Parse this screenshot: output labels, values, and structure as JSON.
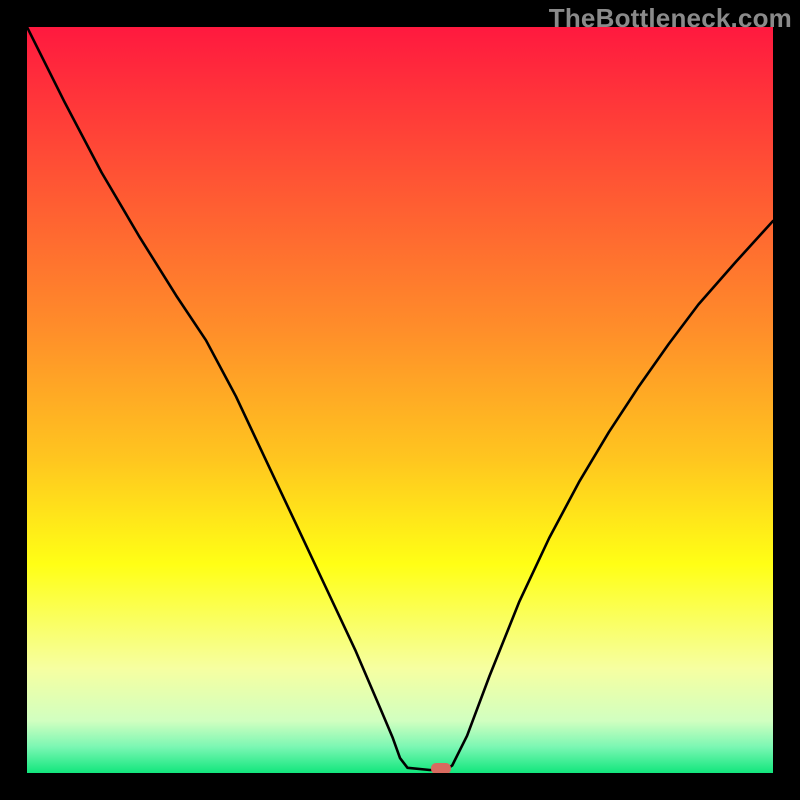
{
  "watermark": "TheBottleneck.com",
  "chart_data": {
    "type": "line",
    "title": "",
    "xlabel": "",
    "ylabel": "",
    "xlim": [
      0,
      1
    ],
    "ylim": [
      0,
      1
    ],
    "gradient_stops": [
      {
        "offset": 0.0,
        "color": "#ff193f"
      },
      {
        "offset": 0.2,
        "color": "#ff5334"
      },
      {
        "offset": 0.4,
        "color": "#ff8c2a"
      },
      {
        "offset": 0.58,
        "color": "#ffc61f"
      },
      {
        "offset": 0.72,
        "color": "#ffff15"
      },
      {
        "offset": 0.86,
        "color": "#f6ffa1"
      },
      {
        "offset": 0.93,
        "color": "#d1ffc0"
      },
      {
        "offset": 0.965,
        "color": "#7bf7b3"
      },
      {
        "offset": 1.0,
        "color": "#12e67d"
      }
    ],
    "x": [
      0.0,
      0.05,
      0.1,
      0.15,
      0.2,
      0.24,
      0.28,
      0.32,
      0.36,
      0.4,
      0.44,
      0.47,
      0.49,
      0.5,
      0.51,
      0.54,
      0.56,
      0.57,
      0.59,
      0.62,
      0.66,
      0.7,
      0.74,
      0.78,
      0.82,
      0.86,
      0.9,
      0.95,
      1.0
    ],
    "y": [
      1.0,
      0.9,
      0.805,
      0.72,
      0.64,
      0.58,
      0.505,
      0.42,
      0.335,
      0.25,
      0.165,
      0.095,
      0.048,
      0.02,
      0.007,
      0.004,
      0.004,
      0.01,
      0.05,
      0.13,
      0.23,
      0.315,
      0.39,
      0.457,
      0.518,
      0.575,
      0.628,
      0.685,
      0.74
    ],
    "marker": {
      "x": 0.555,
      "y": 0.006,
      "color": "#d96a5f"
    }
  }
}
